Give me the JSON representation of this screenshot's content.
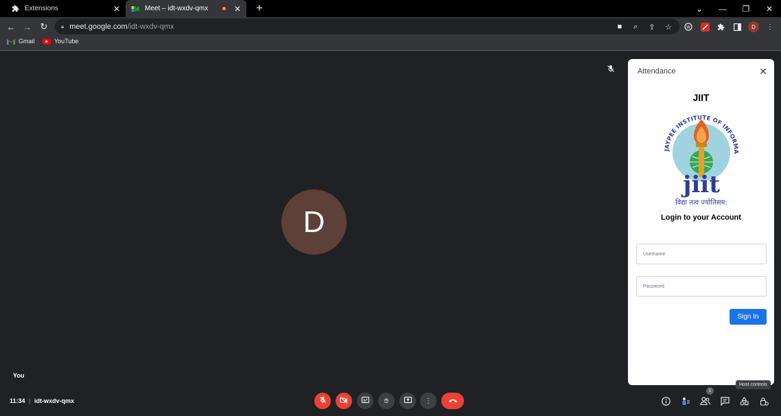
{
  "browser": {
    "tabs": [
      {
        "title": "Extensions",
        "icon": "puzzle-icon"
      },
      {
        "title": "Meet – idt-wxdv-qmx",
        "icon": "meet-icon",
        "recording": true
      }
    ],
    "url_host": "meet.google.com",
    "url_path": "/idt-wxdv-qmx",
    "profile_initial": "D",
    "bookmarks": [
      {
        "label": "Gmail",
        "icon": "gmail-icon"
      },
      {
        "label": "YouTube",
        "icon": "youtube-icon"
      }
    ]
  },
  "meeting": {
    "participant_initial": "D",
    "self_label": "You",
    "time": "11:34",
    "separator": "|",
    "code": "idt-wxdv-qmx",
    "participant_count": "1",
    "tooltip": "Host controls"
  },
  "panel": {
    "title": "Attendance",
    "org_name": "JIIT",
    "logo_ring_text": "JAYPEE INSTITUTE OF INFORMATION TECHNOLOGY",
    "logo_wordmark": "jiit",
    "logo_motto": "विद्या तत्व ज्योतिसम:",
    "login_heading": "Login to your Account",
    "username_placeholder": "Username",
    "password_placeholder": "Password",
    "signin_label": "Sign In"
  },
  "colors": {
    "background": "#202124",
    "accent": "#1a73e8",
    "danger": "#ea4335",
    "avatar": "#5d4037"
  }
}
